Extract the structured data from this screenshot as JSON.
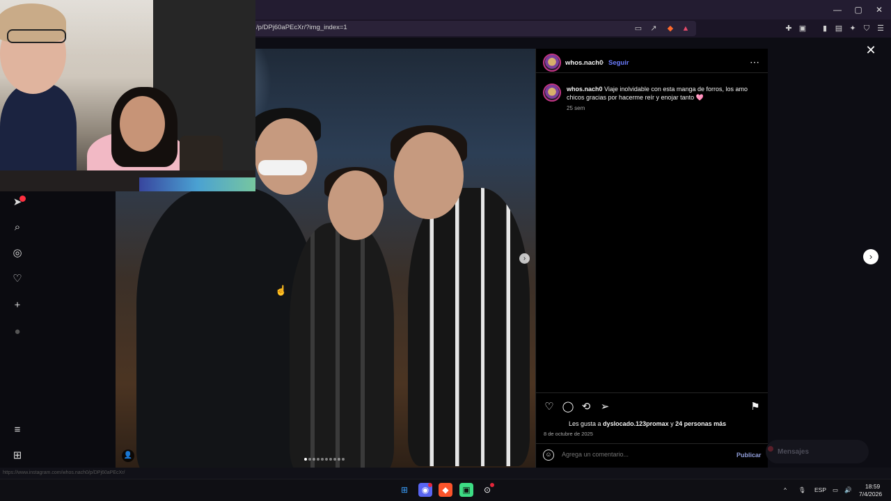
{
  "browser": {
    "url": "/p/DPj60aPEcXr/?img_index=1",
    "window_controls": {
      "minimize": "—",
      "maximize": "▢",
      "close": "✕"
    }
  },
  "icons": {
    "notifications": "notifications-icon",
    "search": "search-icon",
    "explore": "compass-icon",
    "likes": "heart-icon",
    "create": "plus-icon",
    "profile": "avatar-icon",
    "menu": "hamburger-icon",
    "apps": "grid-icon"
  },
  "post": {
    "username": "whos.nach0",
    "follow_label": "Seguir",
    "caption_user": "whos.nach0",
    "caption_text": "Viaje inolvidable con esta manga de forros, los amo chicos gracias por hacerme reír y enojar tanto 🩷",
    "time_ago": "25 sem",
    "likes_prefix": "Les gusta a",
    "likes_user": "dyslocado.123promax",
    "likes_suffix": "y",
    "likes_others": "24 personas más",
    "date": "8 de octubre de 2025",
    "comment_placeholder": "Agrega un comentario...",
    "publish_label": "Publicar",
    "carousel_total": 10,
    "carousel_current": 1
  },
  "overlay": {
    "messages_label": "Mensajes"
  },
  "status_bar": {
    "hover_url": "https://www.instagram.com/whos.nach0/p/DPj60aPEcXr/"
  },
  "taskbar": {
    "language": "ESP",
    "time": "18:59",
    "date": "7/4/2026"
  },
  "colors": {
    "follow": "#6b7cff",
    "background": "#000000",
    "accent_badge": "#ff3040"
  }
}
